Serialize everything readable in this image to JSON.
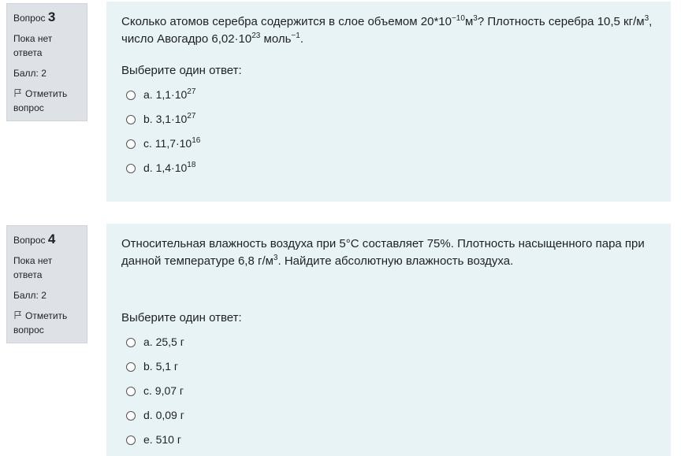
{
  "questions": [
    {
      "label": "Вопрос",
      "number": "3",
      "state": "Пока нет ответа",
      "grade": "Балл: 2",
      "flag": "Отметить вопрос",
      "text_html": "Сколько атомов серебра содержится в слое объемом 20*10<sup>−10</sup>м<sup>3</sup>? Плотность серебра 10,5 кг/м<sup>3</sup>, число Авогадро 6,02·10<sup>23</sup> моль<sup>−1</sup>.",
      "prompt": "Выберите один ответ:",
      "options": [
        {
          "html": "a. 1,1·10<sup>27</sup>"
        },
        {
          "html": "b. 3,1·10<sup>27</sup>"
        },
        {
          "html": "c. 11,7·10<sup>16</sup>"
        },
        {
          "html": "d. 1,4·10<sup>18</sup>"
        }
      ]
    },
    {
      "label": "Вопрос",
      "number": "4",
      "state": "Пока нет ответа",
      "grade": "Балл: 2",
      "flag": "Отметить вопрос",
      "text_html": "Относительная влажность воздуха при 5°С составляет 75%. Плотность насыщенного пара при данной температуре 6,8 г/м<sup>3</sup>. Найдите абсолютную влажность воздуха.",
      "prompt": "Выберите один ответ:",
      "options": [
        {
          "html": "a. 25,5 г"
        },
        {
          "html": "b. 5,1 г"
        },
        {
          "html": "c. 9,07 г"
        },
        {
          "html": "d. 0,09 г"
        },
        {
          "html": "e. 510 г"
        }
      ]
    }
  ]
}
